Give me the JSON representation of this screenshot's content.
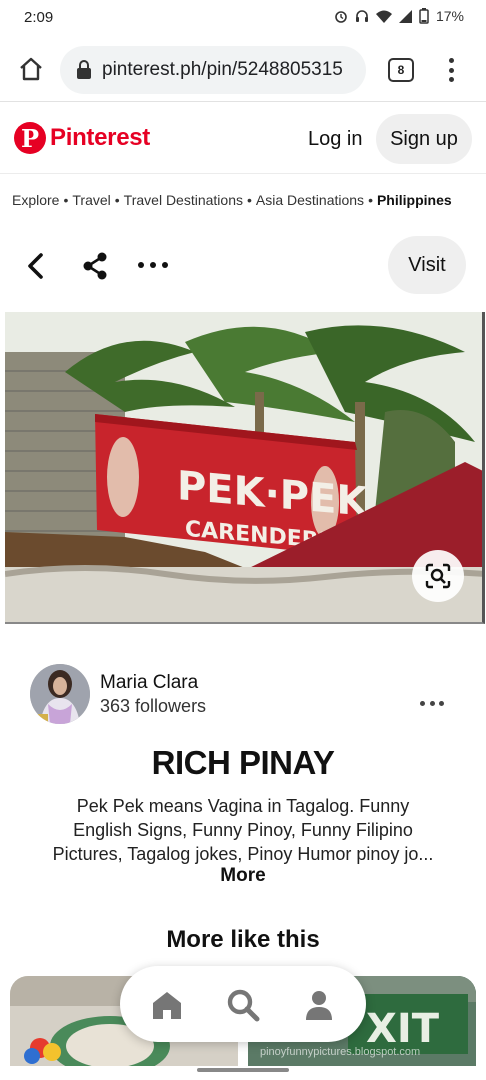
{
  "status_bar": {
    "time": "2:09",
    "battery": "17%"
  },
  "browser": {
    "url": "pinterest.ph/pin/5248805315",
    "tab_count": "8"
  },
  "header": {
    "logo_text": "Pinterest",
    "login_label": "Log in",
    "signup_label": "Sign up",
    "brand_color": "#e60023"
  },
  "breadcrumb": {
    "items": [
      "Explore",
      "Travel",
      "Travel Destinations",
      "Asia Destinations",
      "Philippines"
    ],
    "separator": "•"
  },
  "actions": {
    "visit_label": "Visit"
  },
  "pin": {
    "sign_line1": "PEK·PEK",
    "sign_line2": "CARENDERIA",
    "title": "RICH PINAY",
    "description_lines": [
      "Pek Pek means Vagina in Tagalog. Funny",
      "English Signs, Funny Pinoy, Funny Filipino",
      "Pictures, Tagalog jokes, Pinoy Humor pinoy jo..."
    ],
    "more_label": "More"
  },
  "author": {
    "name": "Maria Clara",
    "followers": "363 followers"
  },
  "related": {
    "heading": "More like this",
    "right_thumb_text": "XIT",
    "right_thumb_caption": "pinoyfunnypictures.blogspot.com"
  },
  "icons": {
    "home": "home-icon",
    "lock": "lock-icon",
    "back": "chevron-left-icon",
    "share": "share-icon",
    "lens": "visual-search-icon",
    "nav_home": "home-icon",
    "nav_search": "search-icon",
    "nav_profile": "profile-icon"
  }
}
